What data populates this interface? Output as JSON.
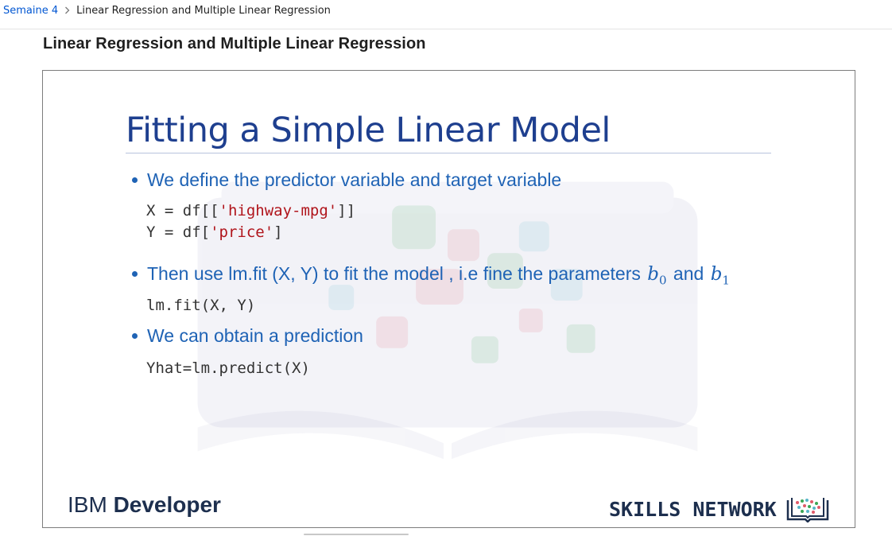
{
  "breadcrumb": {
    "parent": "Semaine 4",
    "current": "Linear Regression and Multiple Linear Regression"
  },
  "page_title": "Linear Regression and Multiple Linear Regression",
  "slide": {
    "title": "Fitting a Simple Linear Model",
    "bullet1": "We define the predictor variable and target variable",
    "code1": {
      "prefix": "X = df[[",
      "string": "'highway-mpg'",
      "suffix": "]]"
    },
    "code2": {
      "prefix": "Y = df[",
      "string": "'price'",
      "suffix": "]"
    },
    "bullet2": {
      "text": "Then use lm.fit (X, Y) to fit the model , i.e fine the parameters",
      "var0": "b",
      "sub0": "0",
      "conj": "and",
      "var1": "b",
      "sub1": "1"
    },
    "code3": "lm.fit(X, Y)",
    "bullet3": "We can obtain a prediction",
    "code4": "Yhat=lm.predict(X)",
    "footer_left_light": "IBM ",
    "footer_left_bold": "Developer",
    "footer_right": "SKILLS NETWORK"
  },
  "colors": {
    "link": "#0056d2",
    "slide_title": "#1e3f8f",
    "bullet": "#1f63b5",
    "code_string": "#b0141b",
    "footer": "#1d2f4e"
  },
  "icons": {
    "breadcrumb_separator": "chevron-right-icon",
    "footer_logo": "skills-network-book-icon"
  }
}
